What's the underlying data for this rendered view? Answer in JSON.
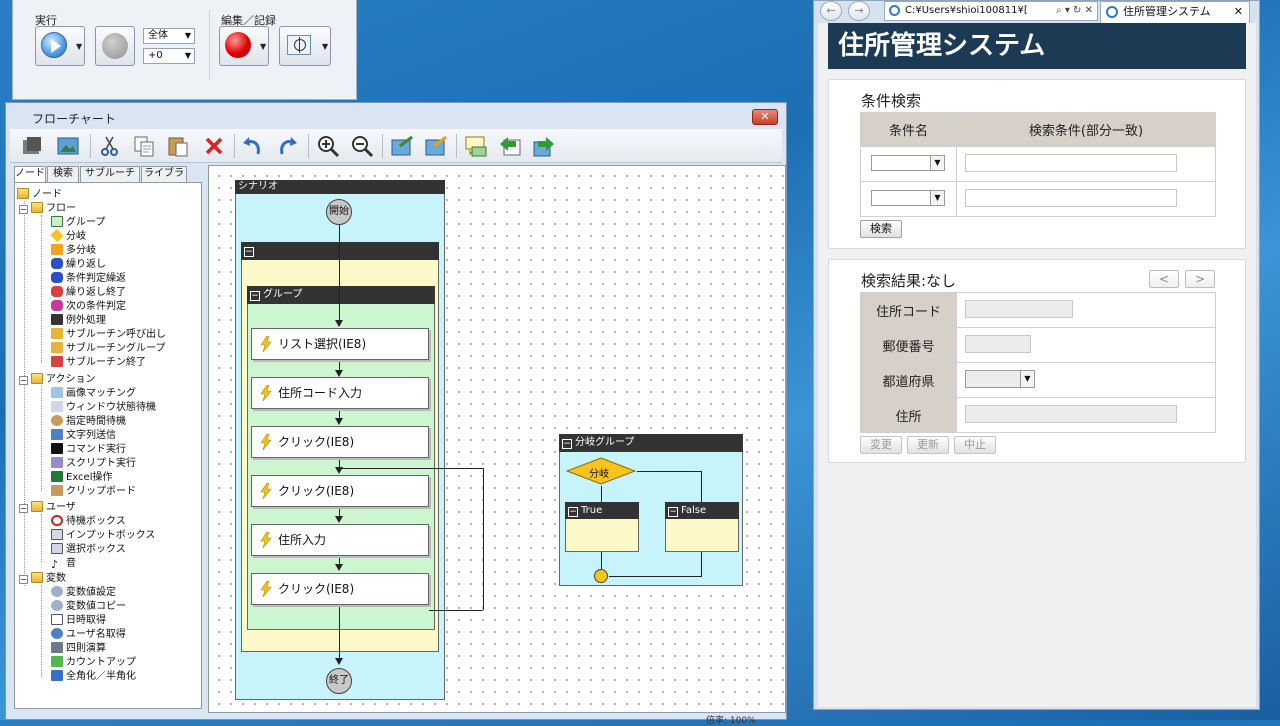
{
  "control_panel": {
    "run_label": "実行",
    "edit_label": "編集／記録",
    "scope_select": "全体",
    "offset_select": "+0"
  },
  "flowchart_window": {
    "title": "フローチャート",
    "close_glyph": "✕",
    "tabs": [
      "ノード",
      "検索",
      "サブルーチン",
      "ライブラリ"
    ],
    "tree": {
      "root": "ノード",
      "groups": [
        {
          "label": "フロー",
          "items": [
            "グループ",
            "分岐",
            "多分岐",
            "繰り返し",
            "条件判定繰返",
            "繰り返し終了",
            "次の条件判定",
            "例外処理",
            "サブルーチン呼び出し",
            "サブルーチングループ",
            "サブルーチン終了"
          ]
        },
        {
          "label": "アクション",
          "items": [
            "画像マッチング",
            "ウィンドウ状態待機",
            "指定時間待機",
            "文字列送信",
            "コマンド実行",
            "スクリプト実行",
            "Excel操作",
            "クリップボード"
          ]
        },
        {
          "label": "ユーザ",
          "items": [
            "待機ボックス",
            "インプットボックス",
            "選択ボックス",
            "音"
          ]
        },
        {
          "label": "変数",
          "items": [
            "変数値設定",
            "変数値コピー",
            "日時取得",
            "ユーザ名取得",
            "四則演算",
            "カウントアップ",
            "全角化／半角化"
          ]
        }
      ]
    },
    "canvas": {
      "scenario_label": "シナリオ",
      "start_label": "開始",
      "end_label": "終了",
      "group_label": "グループ",
      "nodes": [
        "リスト選択(IE8)",
        "住所コード入力",
        "クリック(IE8)",
        "クリック(IE8)",
        "住所入力",
        "クリック(IE8)"
      ],
      "branch_group_label": "分岐グループ",
      "branch_label": "分岐",
      "true_label": "True",
      "false_label": "False"
    },
    "status": "倍率: 100%"
  },
  "browser": {
    "address": "C:¥Users¥shioi100811¥[",
    "address_controls": "⌕ ▾ ↻ ✕",
    "tab_title": "住所管理システム",
    "tab_close": "✕",
    "back_glyph": "←",
    "forward_glyph": "→",
    "page": {
      "banner": "住所管理システム",
      "search_title": "条件検索",
      "col_condition": "条件名",
      "col_criteria": "検索条件(部分一致)",
      "search_button": "検索",
      "result_title": "検索結果:なし",
      "prev_button": "<",
      "next_button": ">",
      "fields": [
        "住所コード",
        "郵便番号",
        "都道府県",
        "住所"
      ],
      "change_button": "変更",
      "update_button": "更新",
      "cancel_button": "中止"
    }
  },
  "colors": {
    "scenario_bg": "#c7f4fb",
    "outer_group_bg": "#fdf8c8",
    "group_bg": "#cdf5cf",
    "branch_diamond": "#f7c31c",
    "banner_bg": "#1d3a55",
    "record_red": "#e00000"
  }
}
